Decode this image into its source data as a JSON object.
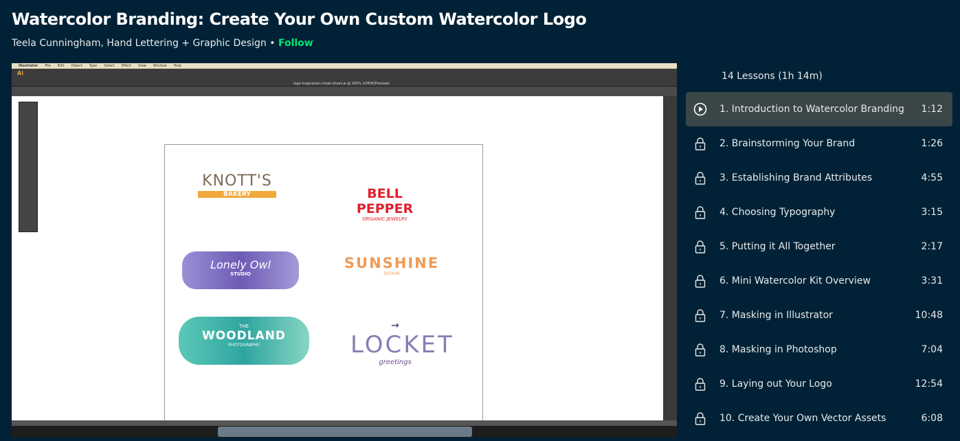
{
  "course": {
    "title": "Watercolor Branding: Create Your Own Custom Watercolor Logo",
    "author": "Teela Cunningham, Hand Lettering + Graphic Design",
    "separator": "•",
    "follow_label": "Follow"
  },
  "video": {
    "menu": [
      "Illustrator",
      "File",
      "Edit",
      "Object",
      "Type",
      "Select",
      "Effect",
      "View",
      "Window",
      "Help"
    ],
    "doc_title": "logo-inspiration-cheat-sheet.ai @ 200% (CMYK/Preview)",
    "logos": [
      "KNOTT'S",
      "BAKERY",
      "BELL PEPPER",
      "ORGANIC JEWELRY",
      "Lonely Owl",
      "STUDIO",
      "SUNSHINE",
      "DESIGN",
      "THE",
      "WOODLAND",
      "PHOTOGRAPHY",
      "LOCKET",
      "greetings"
    ]
  },
  "lessons": {
    "count_label": "14 Lessons (1h 14m)",
    "items": [
      {
        "title": "1. Introduction to Watercolor Branding",
        "duration": "1:12",
        "icon": "play-icon",
        "active": true
      },
      {
        "title": "2. Brainstorming Your Brand",
        "duration": "1:26",
        "icon": "lock-icon"
      },
      {
        "title": "3. Establishing Brand Attributes",
        "duration": "4:55",
        "icon": "lock-icon"
      },
      {
        "title": "4. Choosing Typography",
        "duration": "3:15",
        "icon": "lock-icon"
      },
      {
        "title": "5. Putting it All Together",
        "duration": "2:17",
        "icon": "lock-icon"
      },
      {
        "title": "6. Mini Watercolor Kit Overview",
        "duration": "3:31",
        "icon": "lock-icon"
      },
      {
        "title": "7. Masking in Illustrator",
        "duration": "10:48",
        "icon": "lock-icon"
      },
      {
        "title": "8. Masking in Photoshop",
        "duration": "7:04",
        "icon": "lock-icon"
      },
      {
        "title": "9. Laying out Your Logo",
        "duration": "12:54",
        "icon": "lock-icon"
      },
      {
        "title": "10. Create Your Own Vector Assets",
        "duration": "6:08",
        "icon": "lock-icon"
      }
    ]
  },
  "colors": {
    "background": "#012236",
    "follow": "#00e676",
    "active_row": "#3b4648"
  }
}
